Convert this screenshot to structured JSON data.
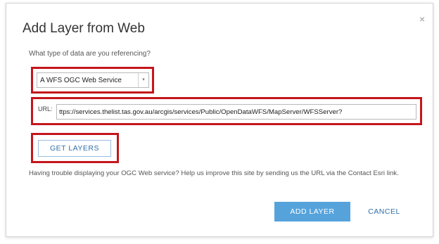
{
  "dialog": {
    "title": "Add Layer from Web",
    "close_icon": "×"
  },
  "data_type": {
    "question": "What type of data are you referencing?",
    "selected": "A WFS OGC Web Service",
    "dropdown_icon": "▾"
  },
  "url": {
    "label": "URL:",
    "value": "ttps://services.thelist.tas.gov.au/arcgis/services/Public/OpenDataWFS/MapServer/WFSServer?"
  },
  "buttons": {
    "get_layers": "GET LAYERS",
    "add_layer": "ADD LAYER",
    "cancel": "CANCEL"
  },
  "help_text": "Having trouble displaying your OGC Web service? Help us improve this site by sending us the URL via the Contact Esri link.",
  "colors": {
    "highlight": "#c4161c",
    "primary_button": "#56a3dc",
    "link_text": "#2f6fa8"
  }
}
